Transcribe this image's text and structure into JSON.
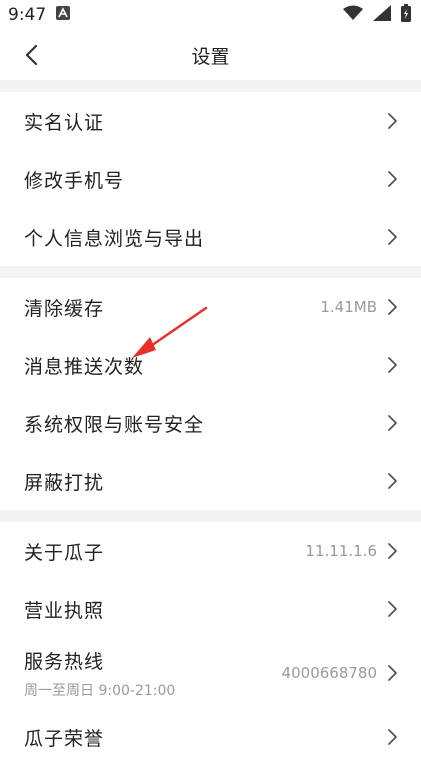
{
  "status": {
    "time": "9:47"
  },
  "nav": {
    "title": "设置"
  },
  "groups": [
    {
      "items": [
        {
          "label": "实名认证"
        },
        {
          "label": "修改手机号"
        },
        {
          "label": "个人信息浏览与导出"
        }
      ]
    },
    {
      "items": [
        {
          "label": "清除缓存",
          "value": "1.41MB"
        },
        {
          "label": "消息推送次数"
        },
        {
          "label": "系统权限与账号安全"
        },
        {
          "label": "屏蔽打扰"
        }
      ]
    },
    {
      "items": [
        {
          "label": "关于瓜子",
          "value": "11.11.1.6"
        },
        {
          "label": "营业执照"
        },
        {
          "label": "服务热线",
          "value": "4000668780",
          "sub": "周一至周日 9:00-21:00"
        },
        {
          "label": "瓜子荣誉"
        }
      ]
    }
  ],
  "colors": {
    "annotation_arrow": "#e8302a",
    "group_gap": "#f3f3f5",
    "secondary_text": "#9a9a9a"
  },
  "icons": {
    "back": "back-chevron-icon",
    "row_arrow": "chevron-right-icon"
  }
}
